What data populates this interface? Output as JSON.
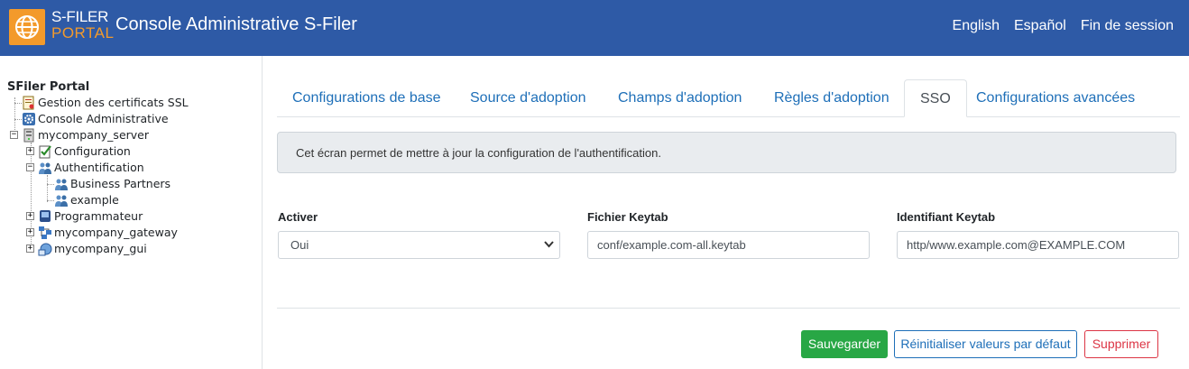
{
  "header": {
    "logo_line1": "S-FILER",
    "logo_line2": "PORTAL",
    "title": "Console Administrative S-Filer",
    "nav": [
      "English",
      "Español",
      "Fin de session"
    ]
  },
  "sidebar": {
    "root": "SFiler Portal",
    "items": [
      {
        "label": "Gestion des certificats SSL",
        "icon": "certificate-icon"
      },
      {
        "label": "Console Administrative",
        "icon": "gear-icon"
      },
      {
        "label": "mycompany_server",
        "icon": "server-icon",
        "expander": "−"
      },
      {
        "label": "Configuration",
        "icon": "checklist-icon",
        "expander": "+"
      },
      {
        "label": "Authentification",
        "icon": "users-icon",
        "expander": "−"
      },
      {
        "label": "Business Partners",
        "icon": "users-icon"
      },
      {
        "label": "example",
        "icon": "users-icon"
      },
      {
        "label": "Programmateur",
        "icon": "scheduler-icon",
        "expander": "+"
      },
      {
        "label": "mycompany_gateway",
        "icon": "network-icon",
        "expander": "+"
      },
      {
        "label": "mycompany_gui",
        "icon": "gui-icon",
        "expander": "+"
      }
    ]
  },
  "tabs": [
    {
      "label": "Configurations de base",
      "active": false
    },
    {
      "label": "Source d'adoption",
      "active": false
    },
    {
      "label": "Champs d'adoption",
      "active": false
    },
    {
      "label": "Règles d'adoption",
      "active": false
    },
    {
      "label": "SSO",
      "active": true
    },
    {
      "label": "Configurations avancées",
      "active": false
    }
  ],
  "info_text": "Cet écran permet de mettre à jour la configuration de l'authentification.",
  "form": {
    "activer_label": "Activer",
    "activer_value": "Oui",
    "keytab_file_label": "Fichier Keytab",
    "keytab_file_value": "conf/example.com-all.keytab",
    "keytab_id_label": "Identifiant Keytab",
    "keytab_id_value": "http/www.example.com@EXAMPLE.COM"
  },
  "buttons": {
    "save": "Sauvegarder",
    "reset": "Réinitialiser valeurs par défaut",
    "delete": "Supprimer"
  },
  "colors": {
    "header_bg": "#2e5aa6",
    "logo_orange": "#f39a2b",
    "link": "#1e6fb8",
    "save_green": "#28a745",
    "delete_red": "#dc3545"
  }
}
